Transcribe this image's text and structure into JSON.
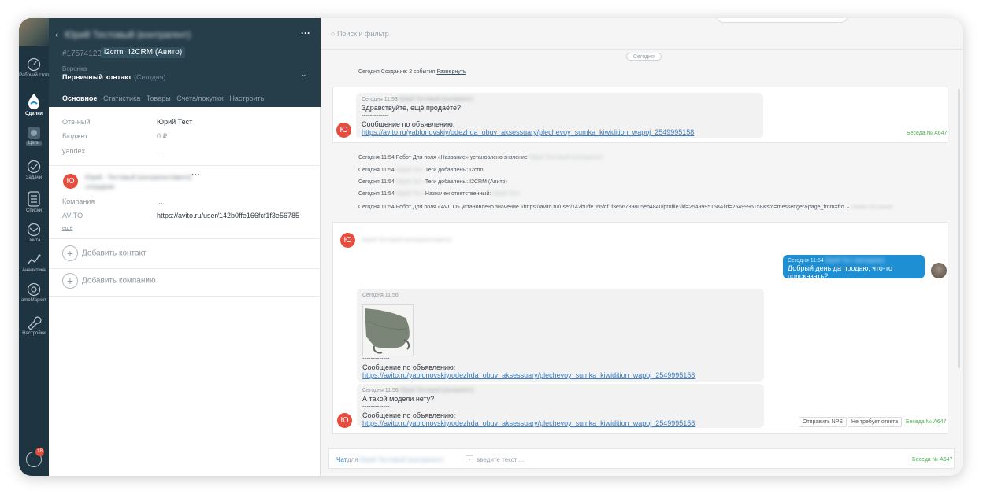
{
  "nav": {
    "items": [
      {
        "label": "Рабочий стол",
        "icon": "dashboard-icon",
        "active": false
      },
      {
        "label": "Сделки",
        "icon": "deals-icon",
        "active": true
      },
      {
        "label": "Цели",
        "icon": "goals-icon",
        "active": false
      },
      {
        "label": "Задачи",
        "icon": "tasks-icon",
        "active": false
      },
      {
        "label": "Списки",
        "icon": "lists-icon",
        "active": false
      },
      {
        "label": "Почта",
        "icon": "mail-icon",
        "active": false
      },
      {
        "label": "Аналитика",
        "icon": "analytics-icon",
        "active": false
      },
      {
        "label": "amoМаркет",
        "icon": "market-icon",
        "active": false
      },
      {
        "label": "Настройки",
        "icon": "settings-icon",
        "active": false
      }
    ],
    "chat_badge": "18"
  },
  "card": {
    "title": "Юрий Тестовый (контрагент)",
    "id": "#17574123",
    "tags": [
      "i2crm",
      "I2CRM (Авито)"
    ],
    "funnel_label": "Воронка",
    "status": "Первичный контакт",
    "status_date": "(Сегодня)",
    "tabs": [
      "Основное",
      "Статистика",
      "Товары",
      "Счета/покупки",
      "Настроить"
    ],
    "fields": [
      {
        "label": "Отв-ный",
        "value": "Юрий Тест"
      },
      {
        "label": "Бюджет",
        "value": "0 ₽"
      },
      {
        "label": "yandex",
        "value": "..."
      }
    ],
    "contact": {
      "initial": "Ю",
      "name": "Юрий - Тестовый (контрагент/авито)",
      "name2": "сотрудник",
      "company_label": "Компания",
      "company_value": "...",
      "avito_label": "AVITO",
      "avito_value": "https://avito.ru/user/142b0ffe166fcf1f3e56785",
      "more": "ещё"
    },
    "add_contact": "Добавить контакт",
    "add_company": "Добавить компанию"
  },
  "feed": {
    "search_placeholder": "Поиск и фильтр",
    "today": "Сегодня",
    "created": {
      "text": "Сегодня Создание: 2 события",
      "link": "Развернуть"
    },
    "convo_label": "Беседа № А647",
    "msg1": {
      "time": "Сегодня 11:53",
      "author": "Юрий Тестовый (контрагент)",
      "text": "Здравствуйте, ещё продаёте?",
      "sep": "-------------",
      "ad_prefix": "Сообщение по объявлению:",
      "ad_link": "https://avito.ru/yablonovskiy/odezhda_obuv_aksessuary/plechevoy_sumka_kiwidition_wapoj_2549995158"
    },
    "events": [
      {
        "prefix": "Сегодня 11:54 Робот Для поля «Название» установлено значение",
        "blur": "Юрий Тестовый (контрагент)"
      },
      {
        "prefix": "Сегодня 11:54",
        "blur": "Юрий Тест",
        "suffix": "Теги добавлены: I2crm"
      },
      {
        "prefix": "Сегодня 11:54",
        "blur": "Юрий Тест",
        "suffix": "Теги добавлены: I2CRM (Авито)"
      },
      {
        "prefix": "Сегодня 11:54",
        "blur": "Юрий Тест",
        "suffix": "Назначен ответственный:",
        "blur2": "Юрий Тест"
      },
      {
        "prefix": "Сегодня 11:54 Робот Для поля «AVITO» установлено значение «https://avito.ru/user/142b0ffe166fcf1f3e56789805eb4840/profile?id=2549995158&iid=2549995158&src=messenger&page_from=fro",
        "blur": "Юрий Тестовый"
      }
    ],
    "chat2_header": "Юрий Тестовый (контрагент/авито)",
    "outgoing": {
      "time": "Сегодня 11:54",
      "author": "Юрий Тест (менеджер)",
      "text": "Добрый день да продаю, что-то подсказать?"
    },
    "msg2": {
      "time": "Сегодня 11:56",
      "sep": "-------------",
      "ad_prefix": "Сообщение по объявлению:"
    },
    "msg3": {
      "time": "Сегодня 11:56",
      "author": "Юрий Тестовый (контрагент)",
      "text": "А такой модели нету?",
      "sep": "-------------",
      "ad_prefix": "Сообщение по объявлению:"
    },
    "btn_nps": "Отправить NPS",
    "btn_noreply": "Не требует ответа",
    "compose": {
      "chat": "Чат",
      "for": "для",
      "name": "Юрий Тестовый (контрагент)",
      "placeholder": "введите текст ..."
    }
  },
  "colors": {
    "nav_bg": "#1f3441",
    "card_head": "#263d4a",
    "accent": "#1f8fd4",
    "avatar": "#e84c3d",
    "convo": "#4caf50"
  }
}
